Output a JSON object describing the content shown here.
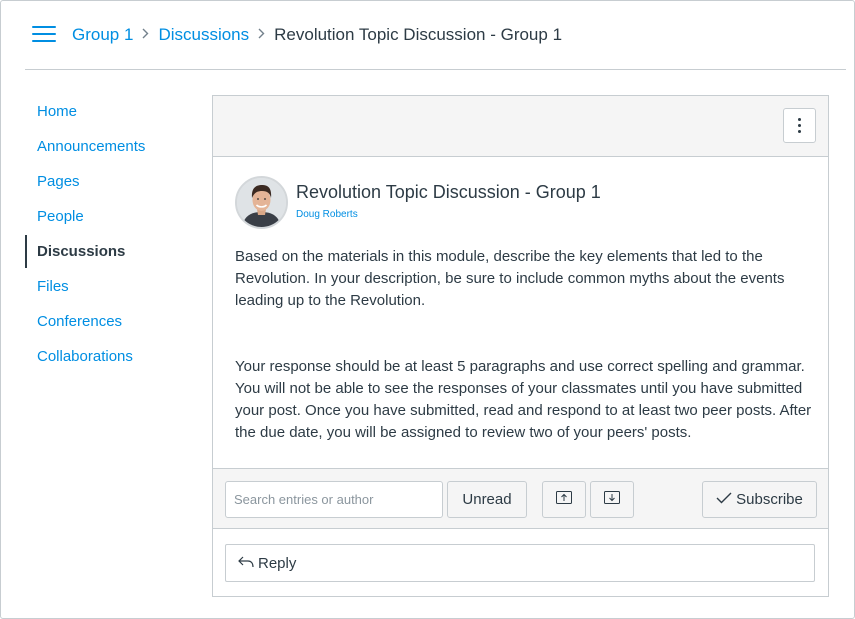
{
  "breadcrumb": {
    "items": [
      {
        "label": "Group 1"
      },
      {
        "label": "Discussions"
      },
      {
        "label": "Revolution Topic Discussion - Group 1"
      }
    ],
    "separator": ">"
  },
  "nav": {
    "items": [
      {
        "label": "Home",
        "active": false
      },
      {
        "label": "Announcements",
        "active": false
      },
      {
        "label": "Pages",
        "active": false
      },
      {
        "label": "People",
        "active": false
      },
      {
        "label": "Discussions",
        "active": true
      },
      {
        "label": "Files",
        "active": false
      },
      {
        "label": "Conferences",
        "active": false
      },
      {
        "label": "Collaborations",
        "active": false
      }
    ]
  },
  "post": {
    "title": "Revolution Topic Discussion - Group 1",
    "author": "Doug Roberts",
    "paragraph1": "Based on the materials in this module, describe the key elements that led to the Revolution. In your description, be sure to include common myths about the events leading up to the Revolution.",
    "paragraph2": "Your response should be at least 5 paragraphs and use correct spelling and grammar. You will not be able to see the responses of your classmates until you have submitted your post. Once you have submitted, read and respond to at least two peer posts. After the due date, you will be assigned to review two of your peers' posts."
  },
  "toolbar": {
    "search_placeholder": "Search entries or author",
    "unread_label": "Unread",
    "subscribe_label": "Subscribe"
  },
  "reply": {
    "label": "Reply"
  },
  "colors": {
    "link": "#008ee2",
    "text": "#2d3b45",
    "border": "#c7cdd1",
    "panel_bg": "#f5f5f5"
  }
}
